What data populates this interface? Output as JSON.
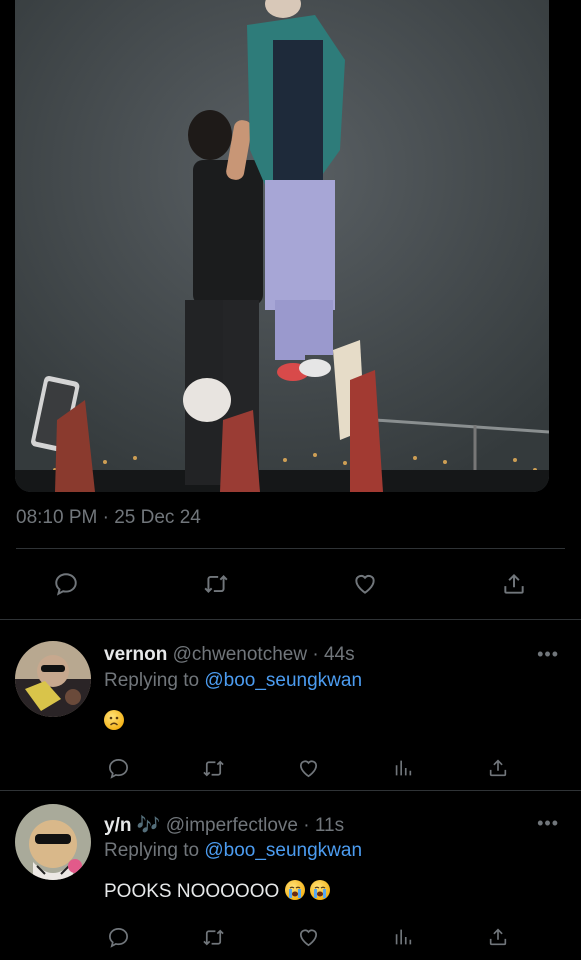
{
  "tweet": {
    "timestamp": "08:10 PM · 25 Dec 24"
  },
  "replies": [
    {
      "name": "vernon",
      "handle": "@chwenotchew",
      "time": "· 44s",
      "replying_prefix": "Replying to",
      "replying_to": "@boo_seungkwan",
      "text": "",
      "emoji_count": 1,
      "more": "•••"
    },
    {
      "name": "y/n",
      "name_badge": "🎶",
      "handle": "@imperfectlove",
      "time": "· 11s",
      "replying_prefix": "Replying to",
      "replying_to": "@boo_seungkwan",
      "text": "POOKS NOOOOOO",
      "emoji_count": 2,
      "more": "•••"
    }
  ],
  "icons": {
    "reply": "speech-bubble-icon",
    "retweet": "retweet-icon",
    "like": "heart-icon",
    "views": "bar-chart-icon",
    "share": "share-icon"
  },
  "colors": {
    "background": "#000000",
    "text": "#e7e9ea",
    "muted": "#71767b",
    "mention": "#4c9cf0",
    "divider": "#2f3336"
  }
}
